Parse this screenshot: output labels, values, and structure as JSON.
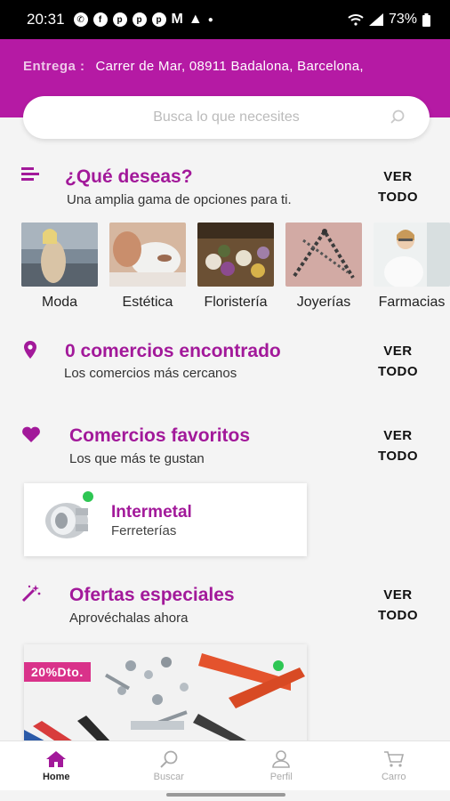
{
  "status_bar": {
    "time": "20:31",
    "battery": "73%",
    "letter_m": "M"
  },
  "header": {
    "delivery_label": "Entrega :",
    "delivery_address": "Carrer de Mar, 08911 Badalona, Barcelona,"
  },
  "search": {
    "placeholder": "Busca lo que necesites"
  },
  "sections": {
    "wishes": {
      "title": "¿Qué deseas?",
      "subtitle": "Una amplia gama de opciones para ti.",
      "see_all_line1": "VER",
      "see_all_line2": "TODO"
    },
    "shops": {
      "title": "0 comercios encontrado",
      "subtitle": "Los comercios más cercanos",
      "see_all_line1": "VER",
      "see_all_line2": "TODO"
    },
    "favorites": {
      "title": "Comercios favoritos",
      "subtitle": "Los que más te gustan",
      "see_all_line1": "VER",
      "see_all_line2": "TODO"
    },
    "offers": {
      "title": "Ofertas especiales",
      "subtitle": "Aprovéchalas ahora",
      "see_all_line1": "VER",
      "see_all_line2": "TODO"
    }
  },
  "categories": [
    {
      "label": "Moda"
    },
    {
      "label": "Estética"
    },
    {
      "label": "Floristería"
    },
    {
      "label": "Joyerías"
    },
    {
      "label": "Farmacias"
    }
  ],
  "favorite_shop": {
    "name": "Intermetal",
    "category": "Ferreterías",
    "status_color": "#2ec653"
  },
  "offer": {
    "badge": "20%Dto."
  },
  "bottom_nav": {
    "home": "Home",
    "search": "Buscar",
    "profile": "Perfil",
    "cart": "Carro"
  },
  "colors": {
    "brand": "#b51aa4",
    "accent_text": "#a2199a",
    "online": "#2ec653",
    "badge": "#d9328a"
  }
}
